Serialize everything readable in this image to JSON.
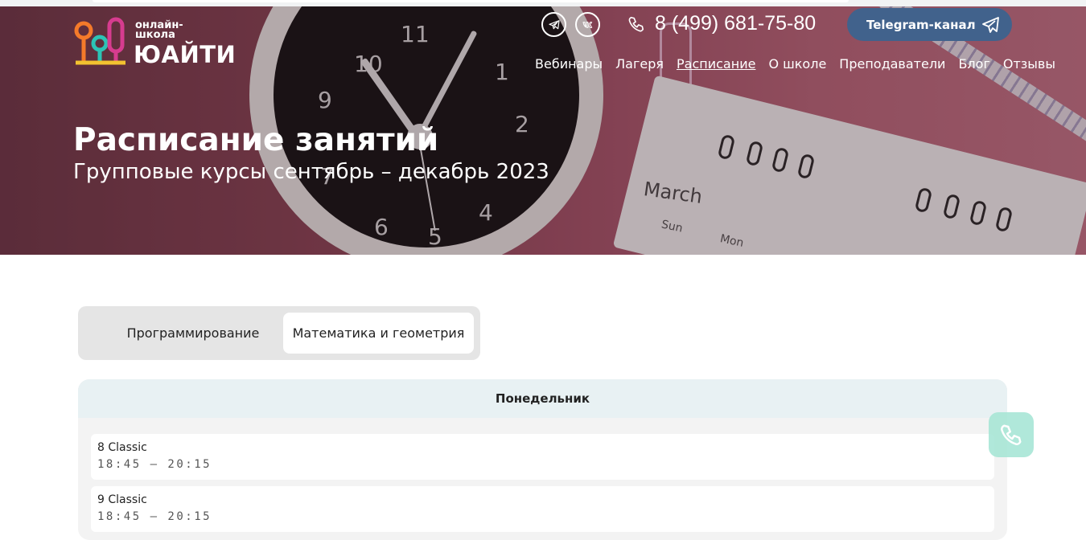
{
  "header": {
    "logo": {
      "small_line1": "онлайн-",
      "small_line2": "школа",
      "name": "ЮАЙТИ"
    },
    "social": [
      {
        "name": "telegram",
        "icon": "telegram-icon"
      },
      {
        "name": "vk",
        "icon": "vk-icon"
      }
    ],
    "phone": "8 (499) 681-75-80",
    "telegram_button": "Telegram-канал",
    "nav": [
      "Вебинары",
      "Лагеря",
      "Расписание",
      "О школе",
      "Преподаватели",
      "Блог",
      "Отзывы"
    ],
    "nav_active": "Расписание"
  },
  "hero": {
    "title": "Расписание занятий",
    "subtitle": "Групповые курсы сентябрь – декабрь 2023",
    "calendar_month": "March",
    "calendar_days": [
      "Sun",
      "Mon"
    ]
  },
  "tabs": {
    "items": [
      "Программирование",
      "Математика и геометрия"
    ],
    "active": "Математика и геометрия"
  },
  "schedule": {
    "day": "Понедельник",
    "lessons": [
      {
        "name": "8 Classic",
        "time": "18:45 – 20:15"
      },
      {
        "name": "9 Classic",
        "time": "18:45 – 20:15"
      }
    ]
  },
  "colors": {
    "tg_button": "#41628c",
    "tab_bg": "#e5e5e5",
    "day_header": "#e8f1f3",
    "call_widget": "#a8e6d6"
  }
}
